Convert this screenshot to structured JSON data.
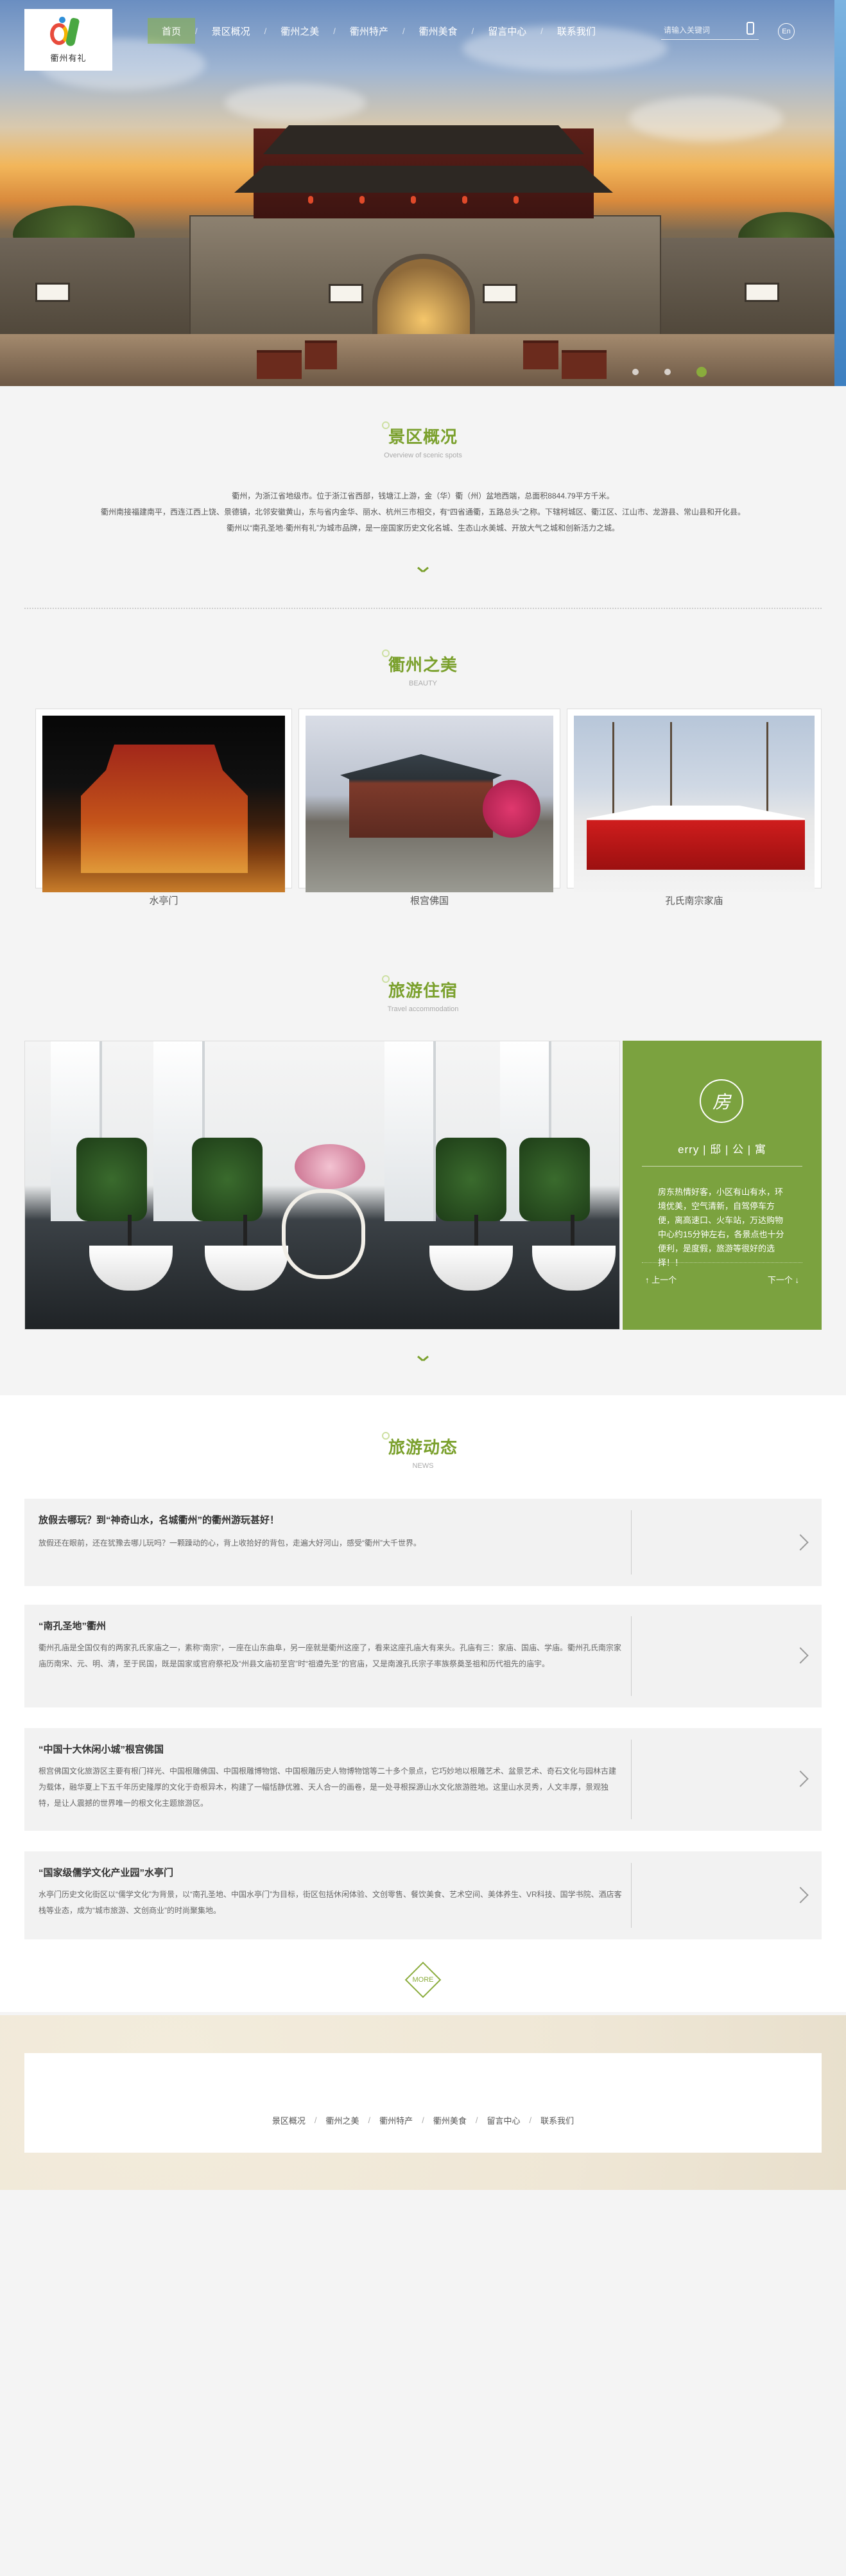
{
  "header": {
    "logo_text": "衢州有礼",
    "nav": [
      {
        "label": "首页",
        "active": true
      },
      {
        "label": "景区概况"
      },
      {
        "label": "衢州之美"
      },
      {
        "label": "衢州特产"
      },
      {
        "label": "衢州美食"
      },
      {
        "label": "留言中心"
      },
      {
        "label": "联系我们"
      }
    ],
    "search_placeholder": "请输入关键词",
    "lang_label": "En"
  },
  "overview": {
    "title": "景区概况",
    "subtitle": "Overview of scenic spots",
    "lines": [
      "衢州，为浙江省地级市。位于浙江省西部，钱塘江上游，金（华）衢（州）盆地西端，总面积8844.79平方千米。",
      "衢州南接福建南平，西连江西上饶、景德镇，北邻安徽黄山，东与省内金华、丽水、杭州三市相交，有“四省通衢，五路总头”之称。下辖柯城区、衢江区、江山市、龙游县、常山县和开化县。",
      "衢州以“南孔圣地·衢州有礼”为城市品牌，是一座国家历史文化名城、生态山水美城、开放大气之城和创新活力之城。"
    ]
  },
  "beauty": {
    "title": "衢州之美",
    "subtitle": "BEAUTY",
    "items": [
      {
        "caption": "水亭门"
      },
      {
        "caption": "根宫佛国"
      },
      {
        "caption": "孔氏南宗家庙"
      }
    ]
  },
  "accommodation": {
    "title": "旅游住宿",
    "subtitle": "Travel accommodation",
    "badge": "房",
    "name": "erry | 邸 | 公 | 寓",
    "desc": "房东热情好客，小区有山有水，环境优美，空气清新，自驾停车方便，离高速口、火车站，万达购物中心约15分钟左右，各景点也十分便利，是度假，旅游等很好的选择！！",
    "prev_label": "上一个",
    "next_label": "下一个"
  },
  "news": {
    "title": "旅游动态",
    "subtitle": "NEWS",
    "items": [
      {
        "title": "放假去哪玩？到“神奇山水，名城衢州”的衢州游玩甚好！",
        "body": "放假还在眼前，还在犹豫去哪儿玩吗？一颗躁动的心，背上收拾好的背包，走遍大好河山，感受“衢州”大千世界。"
      },
      {
        "title": "“南孔圣地”衢州",
        "body": "衢州孔庙是全国仅有的两家孔氏家庙之一，素称“南宗”，一座在山东曲阜，另一座就是衢州这座了，看来这座孔庙大有来头。孔庙有三：家庙、国庙、学庙。衢州孔氏南宗家庙历南宋、元、明、清，至于民国，既是国家或官府祭祀及“州县文庙初至宫”时“祖遵先圣”的官庙，又是南渡孔氏宗子率族祭奠圣祖和历代祖先的庙宇。"
      },
      {
        "title": "“中国十大休闲小城”根宫佛国",
        "body": "根宫佛国文化旅游区主要有根门祥光、中国根雕佛国、中国根雕博物馆、中国根雕历史人物博物馆等二十多个景点，它巧妙地以根雕艺术、盆景艺术、奇石文化与园林古建为载体，融华夏上下五千年历史隆厚的文化于奇根异木，构建了一幅恬静优雅、天人合一的画卷，是一处寻根探源山水文化旅游胜地。这里山水灵秀，人文丰厚，景观独特，是让人震撼的世界唯一的根文化主题旅游区。"
      },
      {
        "title": "“国家级儒学文化产业园”水亭门",
        "body": "水亭门历史文化街区以“儒学文化”为背景，以“南孔圣地、中国水亭门”为目标，街区包括休闲体验、文创零售、餐饮美食、艺术空间、美体养生、VR科技、国学书院、酒店客栈等业态，成为“城市旅游、文创商业”的时尚聚集地。"
      }
    ],
    "more_label": "MORE"
  },
  "footer": {
    "nav": [
      "景区概况",
      "衢州之美",
      "衢州特产",
      "衢州美食",
      "留言中心",
      "联系我们"
    ]
  }
}
